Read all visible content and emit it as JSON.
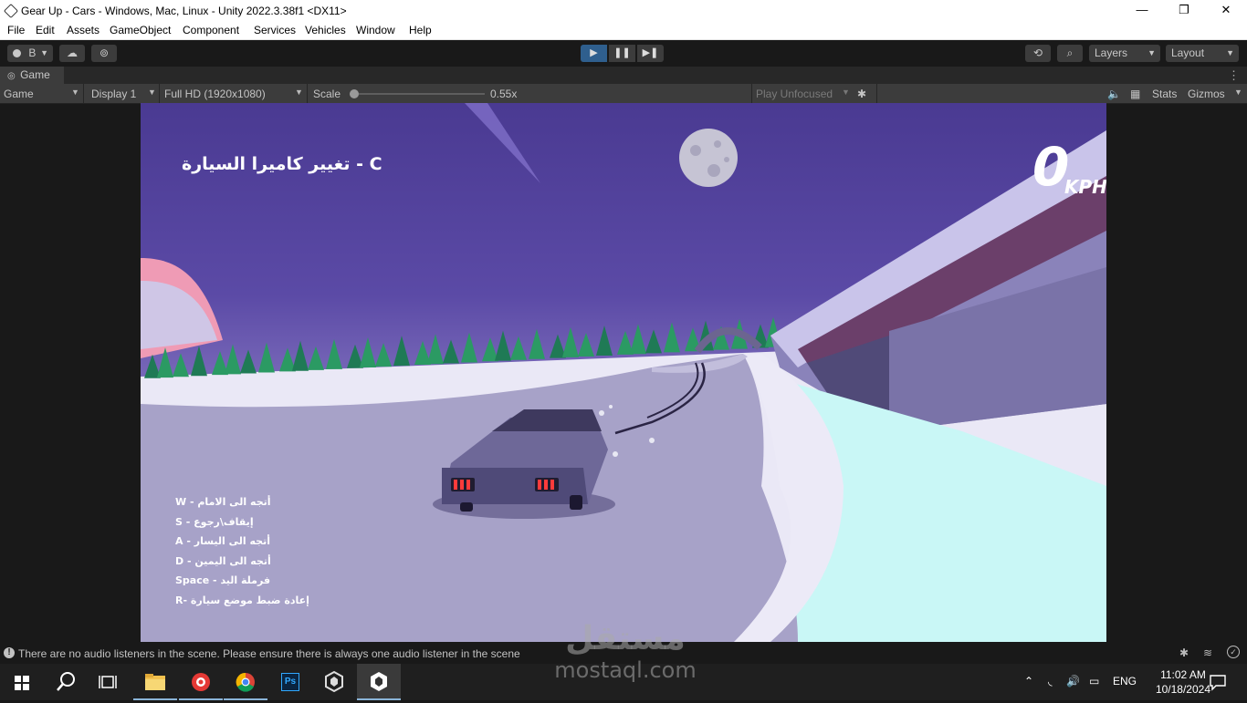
{
  "window": {
    "title": "Gear Up - Cars - Windows, Mac, Linux - Unity 2022.3.38f1 <DX11>",
    "minimize": "—",
    "maximize": "❐",
    "close": "✕"
  },
  "menu": [
    "File",
    "Edit",
    "Assets",
    "GameObject",
    "Component",
    "Services",
    "Vehicles",
    "Window",
    "Help"
  ],
  "toolbar": {
    "account_label": "B",
    "layers_label": "Layers",
    "layout_label": "Layout"
  },
  "tab": {
    "label": "Game"
  },
  "gamebar": {
    "mode": "Game",
    "display": "Display 1",
    "resolution": "Full HD (1920x1080)",
    "scale_label": "Scale",
    "scale_value": "0.55x",
    "scale_level": 0.0,
    "play_focus": "Play Unfocused",
    "stats": "Stats",
    "gizmos": "Gizmos"
  },
  "hud": {
    "camera_hint": "تغيير كاميرا السيارة - C",
    "speed_value": "0",
    "speed_unit": "KPH",
    "controls": [
      {
        "key": "W",
        "action": "أتجه الى الامام"
      },
      {
        "key": "S",
        "action": "إيقاف\\رجوع"
      },
      {
        "key": "A",
        "action": "أتجه الى اليسار"
      },
      {
        "key": "D",
        "action": "أتجه الى اليمين"
      },
      {
        "key": "Space",
        "action": "فرملة اليد"
      },
      {
        "key": "R",
        "action": "إعادة ضبط موضع سيارة"
      }
    ]
  },
  "status": {
    "message": "There are no audio listeners in the scene. Please ensure there is always one audio listener in the scene"
  },
  "taskbar": {
    "lang": "ENG",
    "time": "11:02 AM",
    "date": "10/18/2024",
    "ps_label": "Ps"
  },
  "watermark": {
    "arabic": "مستقل",
    "latin": "mostaql.com"
  },
  "colors": {
    "sky": "#523f9b",
    "ground": "#e9e7f5",
    "road": "#a8a3c9",
    "accent_play": "#2f5f8e"
  }
}
